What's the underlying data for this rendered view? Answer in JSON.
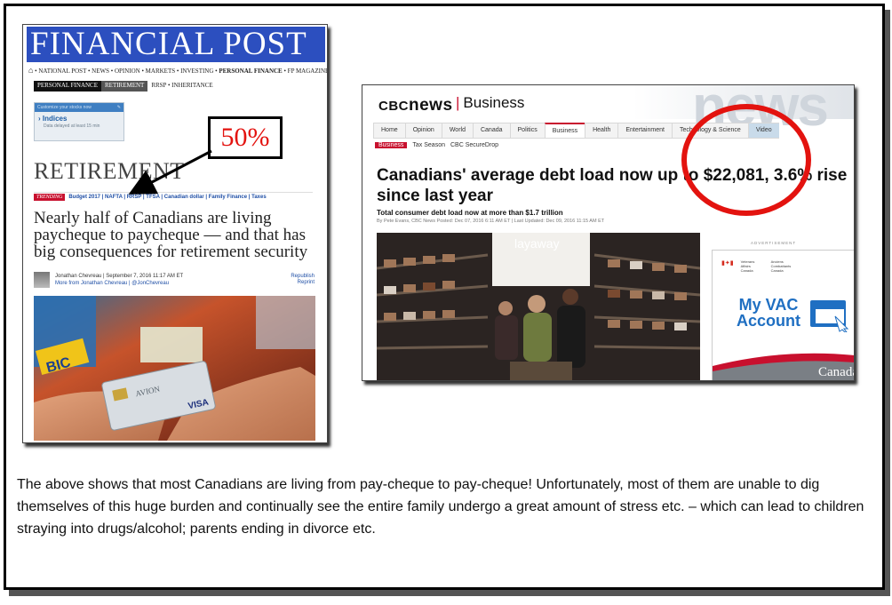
{
  "financial_post": {
    "masthead": "FINANCIAL POST",
    "nav": "• NATIONAL POST • NEWS • OPINION • MARKETS • INVESTING •",
    "nav_bold": "PERSONAL FINANCE",
    "nav_tail": "• FP MAGAZINE • TECH • EXECUTIVE •",
    "subnav": [
      "PERSONAL FINANCE",
      "RETIREMENT",
      "RRSP • INHERITANCE"
    ],
    "stocks_box": {
      "customize": "Customize your stocks now",
      "indices": "Indices",
      "delay": "Data delayed at least 15 min"
    },
    "section_title": "RETIREMENT",
    "trending_label": "TRENDING",
    "trending_links": "Budget 2017 | NAFTA | RRSP | TFSA | Canadian dollar | Family Finance | Taxes",
    "headline": "Nearly half of Canadians are living paycheque to paycheque — and that has big consequences for retirement security",
    "byline": "Jonathan Chevreau | September 7, 2016 11:17 AM ET",
    "byline_more": "More from Jonathan Chevreau | @JonChevreau",
    "republish": "Republish\nReprint",
    "card_text": [
      "AVION",
      "VISA"
    ],
    "bic": "BIC"
  },
  "callout": {
    "text": "50%"
  },
  "cbc": {
    "logo_cbc": "CBC",
    "logo_news": "news",
    "section": "Business",
    "bg_word": "news",
    "nav": [
      "Home",
      "Opinion",
      "World",
      "Canada",
      "Politics",
      "Business",
      "Health",
      "Entertainment",
      "Technology & Science",
      "Video"
    ],
    "subnav": [
      "Business",
      "Tax Season",
      "CBC SecureDrop"
    ],
    "headline": "Canadians' average debt load now up to $22,081, 3.6% rise since last year",
    "dek": "Total consumer debt load now at more than $1.7 trillion",
    "meta": "By Pete Evans, CBC News   Posted: Dec 07, 2016 6:11 AM ET   |   Last Updated: Dec 09, 2016 11:15 AM ET",
    "photo_sign": "layaway",
    "ad_label": "ADVERTISEMENT",
    "ad_org_en": "Veterans Affairs Canada",
    "ad_org_fr": "Anciens Combattants Canada",
    "ad_text": "My VAC Account",
    "ad_canada": "Canada"
  },
  "caption": "The above shows that most Canadians are living from pay-cheque to pay-cheque! Unfortunately, most of them are unable to dig themselves of this huge burden and continually see the entire family undergo a great amount of stress etc. – which can lead to children straying into drugs/alcohol; parents ending in divorce etc."
}
